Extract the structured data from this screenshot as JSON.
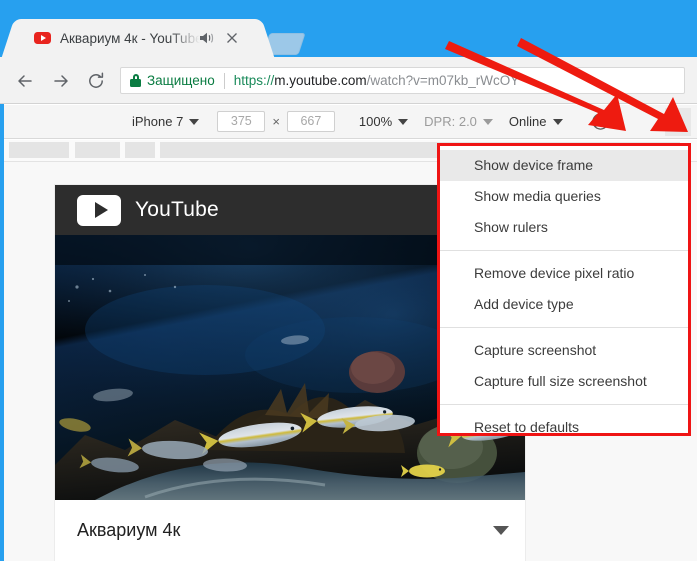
{
  "browser": {
    "tab": {
      "title": "Аквариум 4к - YouTube",
      "favicon": "youtube-favicon",
      "audio_icon": "speaker-icon",
      "close_icon": "close-icon"
    },
    "new_tab_label": "",
    "nav": {
      "back": "back-arrow-icon",
      "forward": "forward-arrow-icon",
      "reload": "reload-icon"
    },
    "omnibox": {
      "security_icon": "lock-icon",
      "security_label": "Защищено",
      "url_scheme": "https://",
      "url_host": "m.youtube.com",
      "url_path": "/watch?v=m07kb_rWcOY"
    }
  },
  "device_toolbar": {
    "device_name": "iPhone 7",
    "width_value": "375",
    "height_value": "667",
    "dimension_separator": "×",
    "zoom": "100%",
    "dpr_label": "DPR: 2.0",
    "network": "Online",
    "rotate_icon": "rotate-device-icon",
    "more_icon": "three-dots-vertical-icon"
  },
  "menu": {
    "groups": [
      {
        "items": [
          {
            "label": "Show device frame",
            "hovered": true
          },
          {
            "label": "Show media queries",
            "hovered": false
          },
          {
            "label": "Show rulers",
            "hovered": false
          }
        ]
      },
      {
        "items": [
          {
            "label": "Remove device pixel ratio",
            "hovered": false
          },
          {
            "label": "Add device type",
            "hovered": false
          }
        ]
      },
      {
        "items": [
          {
            "label": "Capture screenshot",
            "hovered": false
          },
          {
            "label": "Capture full size screenshot",
            "hovered": false
          }
        ]
      },
      {
        "items": [
          {
            "label": "Reset to defaults",
            "hovered": false
          }
        ]
      }
    ]
  },
  "page": {
    "site_name": "YouTube",
    "logo_icon": "youtube-play-icon",
    "video_title": "Аквариум 4к",
    "expand_icon": "chevron-down-icon",
    "video_scene": "underwater-aquarium-with-fish"
  },
  "annotations": {
    "arrow_color": "#ee1b10",
    "highlight_border_color": "#ef1414",
    "arrows": [
      {
        "name": "arrow-to-rotate-icon"
      },
      {
        "name": "arrow-to-more-menu"
      }
    ]
  },
  "colors": {
    "chrome_blue": "#27a0ef",
    "secure_green": "#0a7c42",
    "yt_red": "#e8241e",
    "toolbar_grey": "#f2f2f2"
  }
}
